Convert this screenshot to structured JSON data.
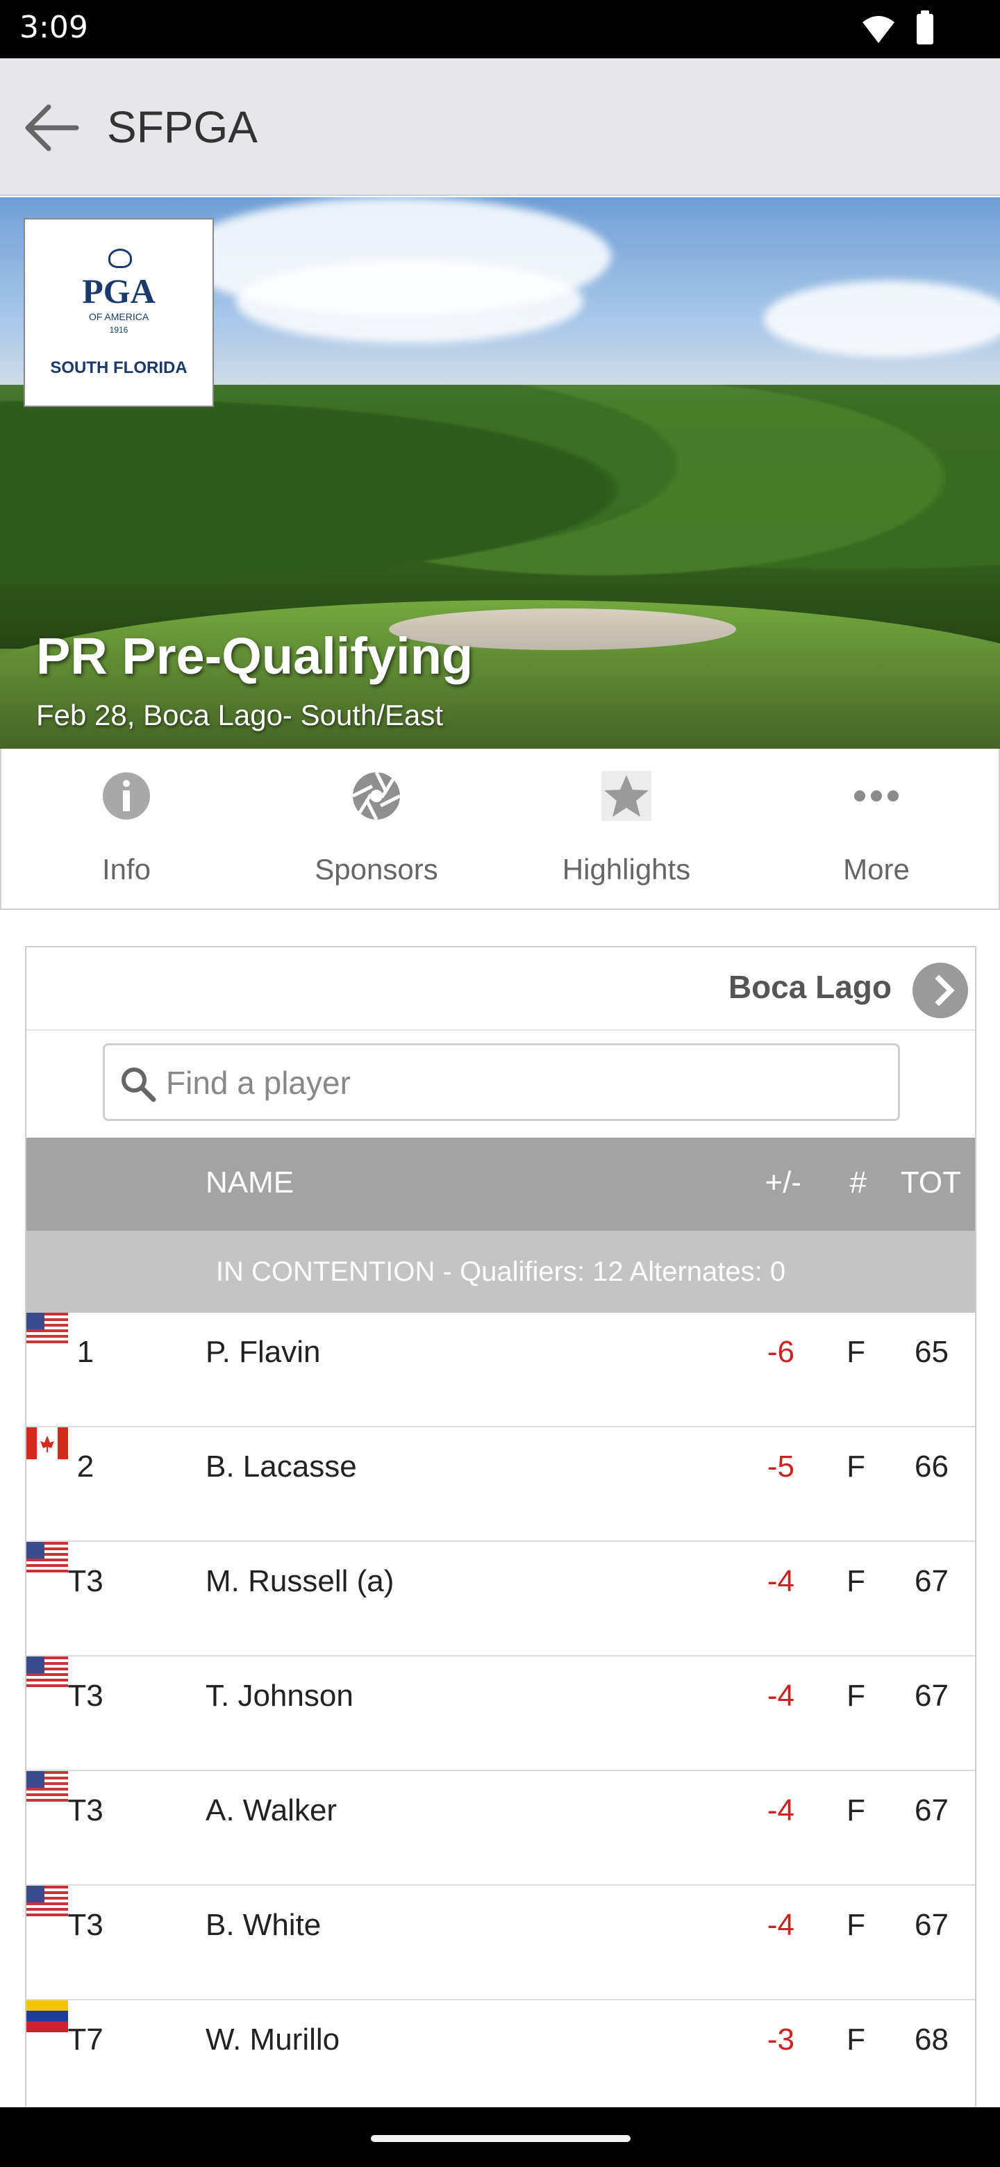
{
  "status_bar": {
    "time": "3:09"
  },
  "app_bar": {
    "title": "SFPGA"
  },
  "hero": {
    "logo": {
      "brand": "PGA",
      "line1": "OF AMERICA",
      "year": "1916",
      "region": "SOUTH FLORIDA"
    },
    "event_title": "PR Pre-Qualifying",
    "event_subtitle": "Feb 28, Boca Lago- South/East"
  },
  "nav_tabs": [
    {
      "label": "Info",
      "icon": "info-icon"
    },
    {
      "label": "Sponsors",
      "icon": "aperture-icon"
    },
    {
      "label": "Highlights",
      "icon": "star-icon"
    },
    {
      "label": "More",
      "icon": "more-dots-icon"
    }
  ],
  "leaderboard": {
    "course": "Boca Lago",
    "search_placeholder": "Find a player",
    "columns": {
      "name": "NAME",
      "par": "+/-",
      "thru": "#",
      "total": "TOT"
    },
    "banner": "IN CONTENTION - Qualifiers: 12  Alternates: 0",
    "colors": {
      "under_par": "#cc2222",
      "header_bg": "#a3a3a3",
      "banner_bg": "#c4c4c4"
    },
    "rows": [
      {
        "pos": "1",
        "flag": "us-flag",
        "name": "P. Flavin",
        "par": "-6",
        "thru": "F",
        "tot": "65"
      },
      {
        "pos": "2",
        "flag": "canada-flag",
        "name": "B. Lacasse",
        "par": "-5",
        "thru": "F",
        "tot": "66"
      },
      {
        "pos": "T3",
        "flag": "us-flag",
        "name": "M. Russell (a)",
        "par": "-4",
        "thru": "F",
        "tot": "67"
      },
      {
        "pos": "T3",
        "flag": "us-flag",
        "name": "T. Johnson",
        "par": "-4",
        "thru": "F",
        "tot": "67"
      },
      {
        "pos": "T3",
        "flag": "us-flag",
        "name": "A. Walker",
        "par": "-4",
        "thru": "F",
        "tot": "67"
      },
      {
        "pos": "T3",
        "flag": "us-flag",
        "name": "B. White",
        "par": "-4",
        "thru": "F",
        "tot": "67"
      },
      {
        "pos": "T7",
        "flag": "venezuela-flag",
        "name": "W. Murillo",
        "par": "-3",
        "thru": "F",
        "tot": "68"
      }
    ]
  }
}
